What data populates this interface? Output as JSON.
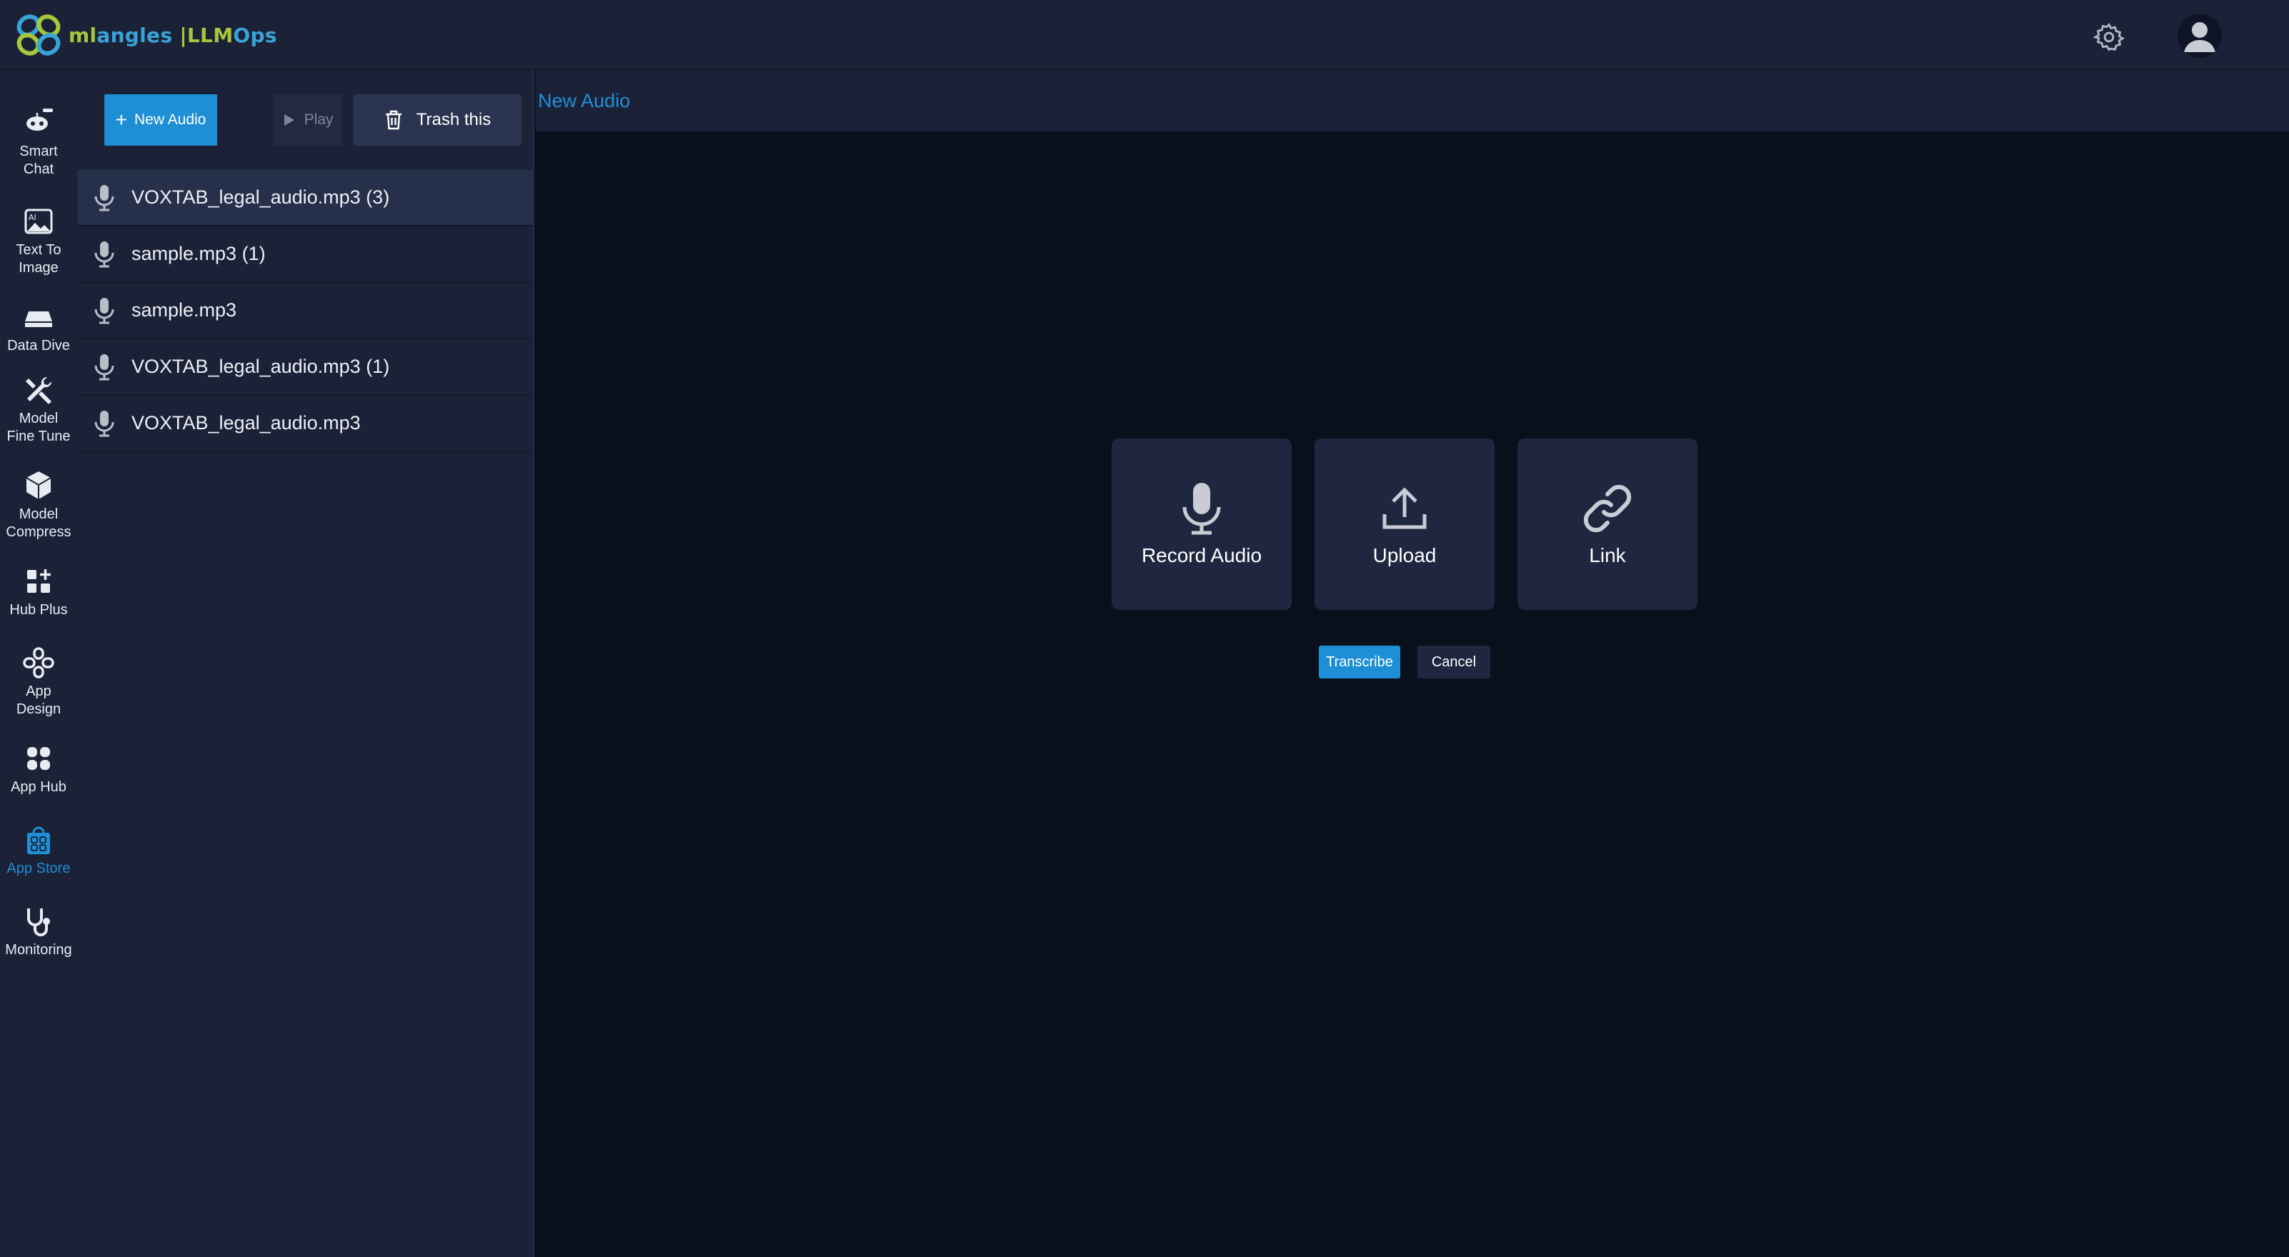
{
  "brand": {
    "ml": "ml",
    "angles": "angles",
    "sep": "|",
    "llm": "LLM",
    "ops": "Ops"
  },
  "topbar": {
    "settings_icon": "gear-icon",
    "avatar_icon": "user-avatar-icon"
  },
  "sidenav": {
    "items": [
      {
        "label": "Smart Chat",
        "icon": "robot-icon"
      },
      {
        "label": "Text To Image",
        "icon": "image-icon"
      },
      {
        "label": "Data Dive",
        "icon": "drive-icon"
      },
      {
        "label": "Model Fine Tune",
        "icon": "tools-icon"
      },
      {
        "label": "Model Compress",
        "icon": "cube-icon"
      },
      {
        "label": "Hub Plus",
        "icon": "grid-plus-icon"
      },
      {
        "label": "App Design",
        "icon": "app-design-icon"
      },
      {
        "label": "App Hub",
        "icon": "app-hub-icon"
      },
      {
        "label": "App Store",
        "icon": "shopping-bag-icon",
        "active": true
      },
      {
        "label": "Monitoring",
        "icon": "stethoscope-icon"
      }
    ],
    "active_color": "#1e8fd6"
  },
  "toolbar": {
    "new_label": "New Audio",
    "play_label": "Play",
    "trash_label": "Trash this"
  },
  "audio_files": [
    {
      "name": "VOXTAB_legal_audio.mp3 (3)",
      "selected": true
    },
    {
      "name": "sample.mp3 (1)"
    },
    {
      "name": "sample.mp3"
    },
    {
      "name": "VOXTAB_legal_audio.mp3 (1)"
    },
    {
      "name": "VOXTAB_legal_audio.mp3"
    }
  ],
  "main": {
    "header": "New Audio",
    "options": [
      {
        "label": "Record Audio",
        "icon": "microphone-icon"
      },
      {
        "label": "Upload",
        "icon": "upload-icon"
      },
      {
        "label": "Link",
        "icon": "link-icon"
      }
    ],
    "transcribe_label": "Transcribe",
    "cancel_label": "Cancel"
  },
  "colors": {
    "accent": "#1e8fd6",
    "background": "#0a0f1c",
    "panel": "#1b2238",
    "card": "#1f2740"
  }
}
